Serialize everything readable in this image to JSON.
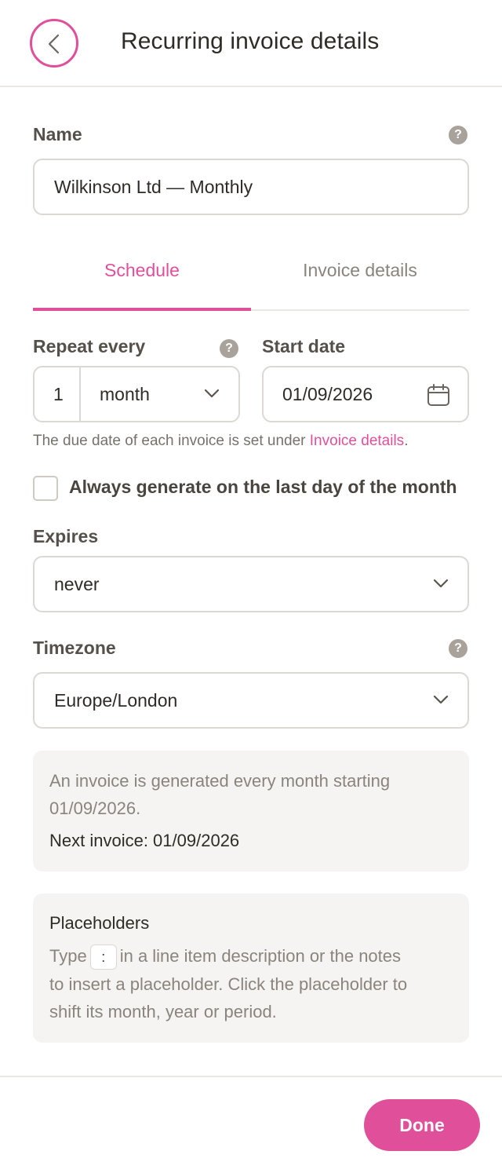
{
  "header": {
    "title": "Recurring invoice details",
    "back_icon": "chevron-left-icon"
  },
  "name_field": {
    "label": "Name",
    "value": "Wilkinson Ltd — Monthly",
    "help": "?"
  },
  "tabs": [
    {
      "label": "Schedule",
      "active": true
    },
    {
      "label": "Invoice details",
      "active": false
    }
  ],
  "repeat": {
    "label": "Repeat every",
    "help": "?",
    "count": "1",
    "unit": "month"
  },
  "start_date": {
    "label": "Start date",
    "value": "01/09/2026",
    "icon": "calendar-icon"
  },
  "due_note": {
    "text": "The due date of each invoice is set under ",
    "link": "Invoice details",
    "suffix": "."
  },
  "last_day_checkbox": {
    "label": "Always generate on the last day of the month",
    "checked": false
  },
  "expires": {
    "label": "Expires",
    "value": "never"
  },
  "timezone": {
    "label": "Timezone",
    "help": "?",
    "value": "Europe/London"
  },
  "summary": {
    "line1": "An invoice is generated every month starting",
    "line2": "01/09/2026.",
    "next": "Next invoice: 01/09/2026"
  },
  "placeholders": {
    "title": "Placeholders",
    "before_key": "Type",
    "key": ":",
    "after_key": "in a line item description or the notes",
    "line2": "to insert a placeholder. Click the placeholder to",
    "line3": "shift its month, year or period."
  },
  "footer": {
    "done_label": "Done"
  },
  "colors": {
    "accent": "#e0509a",
    "border": "#dcd8d3",
    "panel": "#f5f4f2"
  }
}
